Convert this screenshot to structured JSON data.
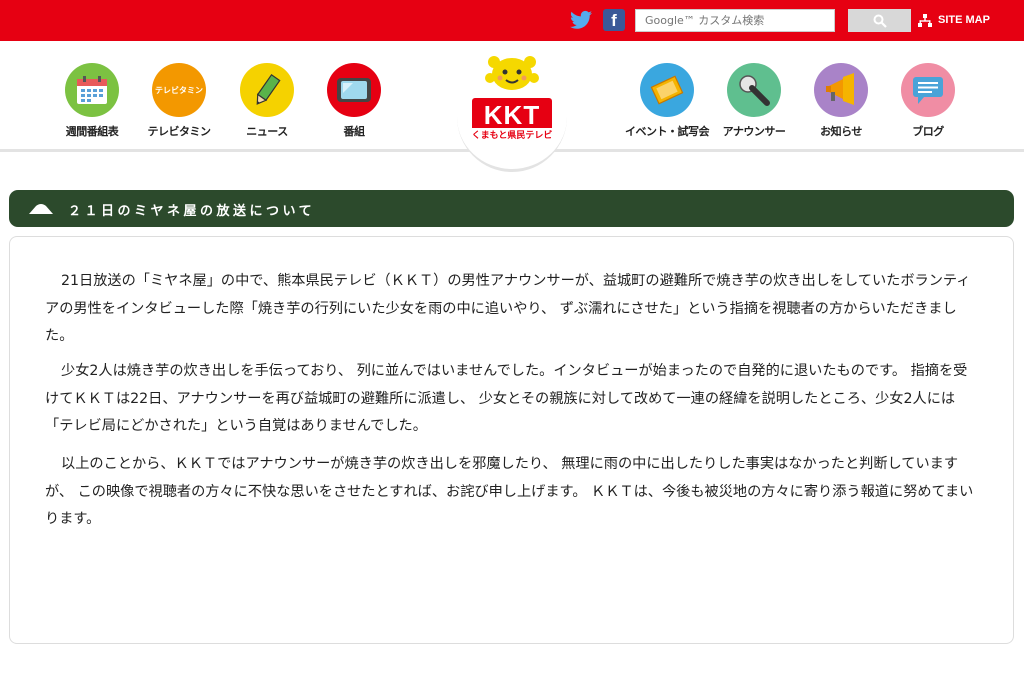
{
  "topbar": {
    "search_placeholder": "Google™ カスタム検索",
    "sitemap_label": "SITE MAP",
    "color": "#e60012",
    "icons": [
      "twitter-icon",
      "facebook-icon",
      "search-icon",
      "sitemap-icon"
    ]
  },
  "nav": {
    "left": [
      {
        "label": "週間番組表",
        "color": "#7cc242",
        "icon": "calendar-icon"
      },
      {
        "label": "テレビタミン",
        "color": "#f39800",
        "icon": "televitamin-icon",
        "badge": "テレビタミン"
      },
      {
        "label": "ニュース",
        "color": "#f5d200",
        "icon": "pencil-icon"
      },
      {
        "label": "番組",
        "color": "#e60012",
        "icon": "tv-icon"
      }
    ],
    "right": [
      {
        "label": "イベント・試写会",
        "color": "#3aa7df",
        "icon": "ticket-icon"
      },
      {
        "label": "アナウンサー",
        "color": "#5fbf8f",
        "icon": "microphone-icon"
      },
      {
        "label": "お知らせ",
        "color": "#a983c8",
        "icon": "megaphone-icon"
      },
      {
        "label": "ブログ",
        "color": "#f08da4",
        "icon": "speech-bubble-icon"
      }
    ]
  },
  "logo": {
    "main": "KKT",
    "sub": "くまもと県民テレビ"
  },
  "article": {
    "title": "２１日のミヤネ屋の放送について",
    "paragraphs": [
      "21日放送の「ミヤネ屋」の中で、熊本県民テレビ（ＫＫＴ）の男性アナウンサーが、益城町の避難所で焼き芋の炊き出しをしていたボランティアの男性をインタビューした際「焼き芋の行列にいた少女を雨の中に追いやり、 ずぶ濡れにさせた」という指摘を視聴者の方からいただきました。",
      "少女2人は焼き芋の炊き出しを手伝っており、 列に並んではいませんでした。インタビューが始まったので自発的に退いたものです。 指摘を受けてＫＫＴは22日、アナウンサーを再び益城町の避難所に派遣し、 少女とその親族に対して改めて一連の経緯を説明したところ、少女2人には「テレビ局にどかされた」という自覚はありませんでした。",
      "以上のことから、ＫＫＴではアナウンサーが焼き芋の炊き出しを邪魔したり、 無理に雨の中に出したりした事実はなかったと判断していますが、 この映像で視聴者の方々に不快な思いをさせたとすれば、お詫び申し上げます。 ＫＫＴは、今後も被災地の方々に寄り添う報道に努めてまいります。"
    ]
  },
  "colors": {
    "heading_bg": "#2c4a2c",
    "brand_red": "#e60012"
  }
}
